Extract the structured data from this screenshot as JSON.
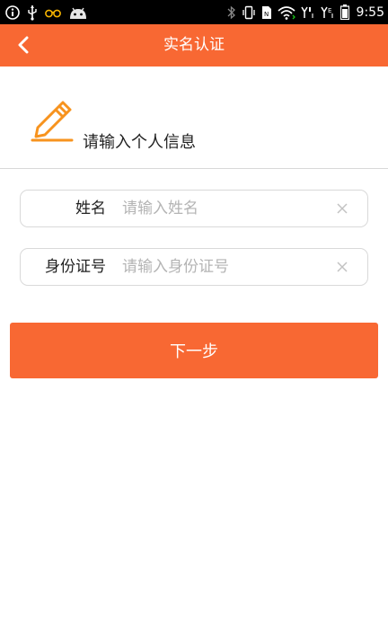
{
  "status_bar": {
    "time": "9:55",
    "icons": [
      "info-icon",
      "usb-icon",
      "glasses-icon",
      "android-icon",
      "bluetooth-icon",
      "vibrate-icon",
      "sim-icon",
      "wifi-icon",
      "signal-1-icon",
      "signal-2-icon",
      "battery-icon"
    ]
  },
  "header": {
    "title": "实名认证",
    "color": "#f86833"
  },
  "intro": {
    "text": "请输入个人信息",
    "icon": "pencil-icon",
    "icon_color": "#f7931e"
  },
  "form": {
    "name": {
      "label": "姓名",
      "placeholder": "请输入姓名",
      "value": ""
    },
    "id_number": {
      "label": "身份证号",
      "placeholder": "请输入身份证号",
      "value": ""
    }
  },
  "next_button": {
    "label": "下一步",
    "color": "#f86833"
  }
}
